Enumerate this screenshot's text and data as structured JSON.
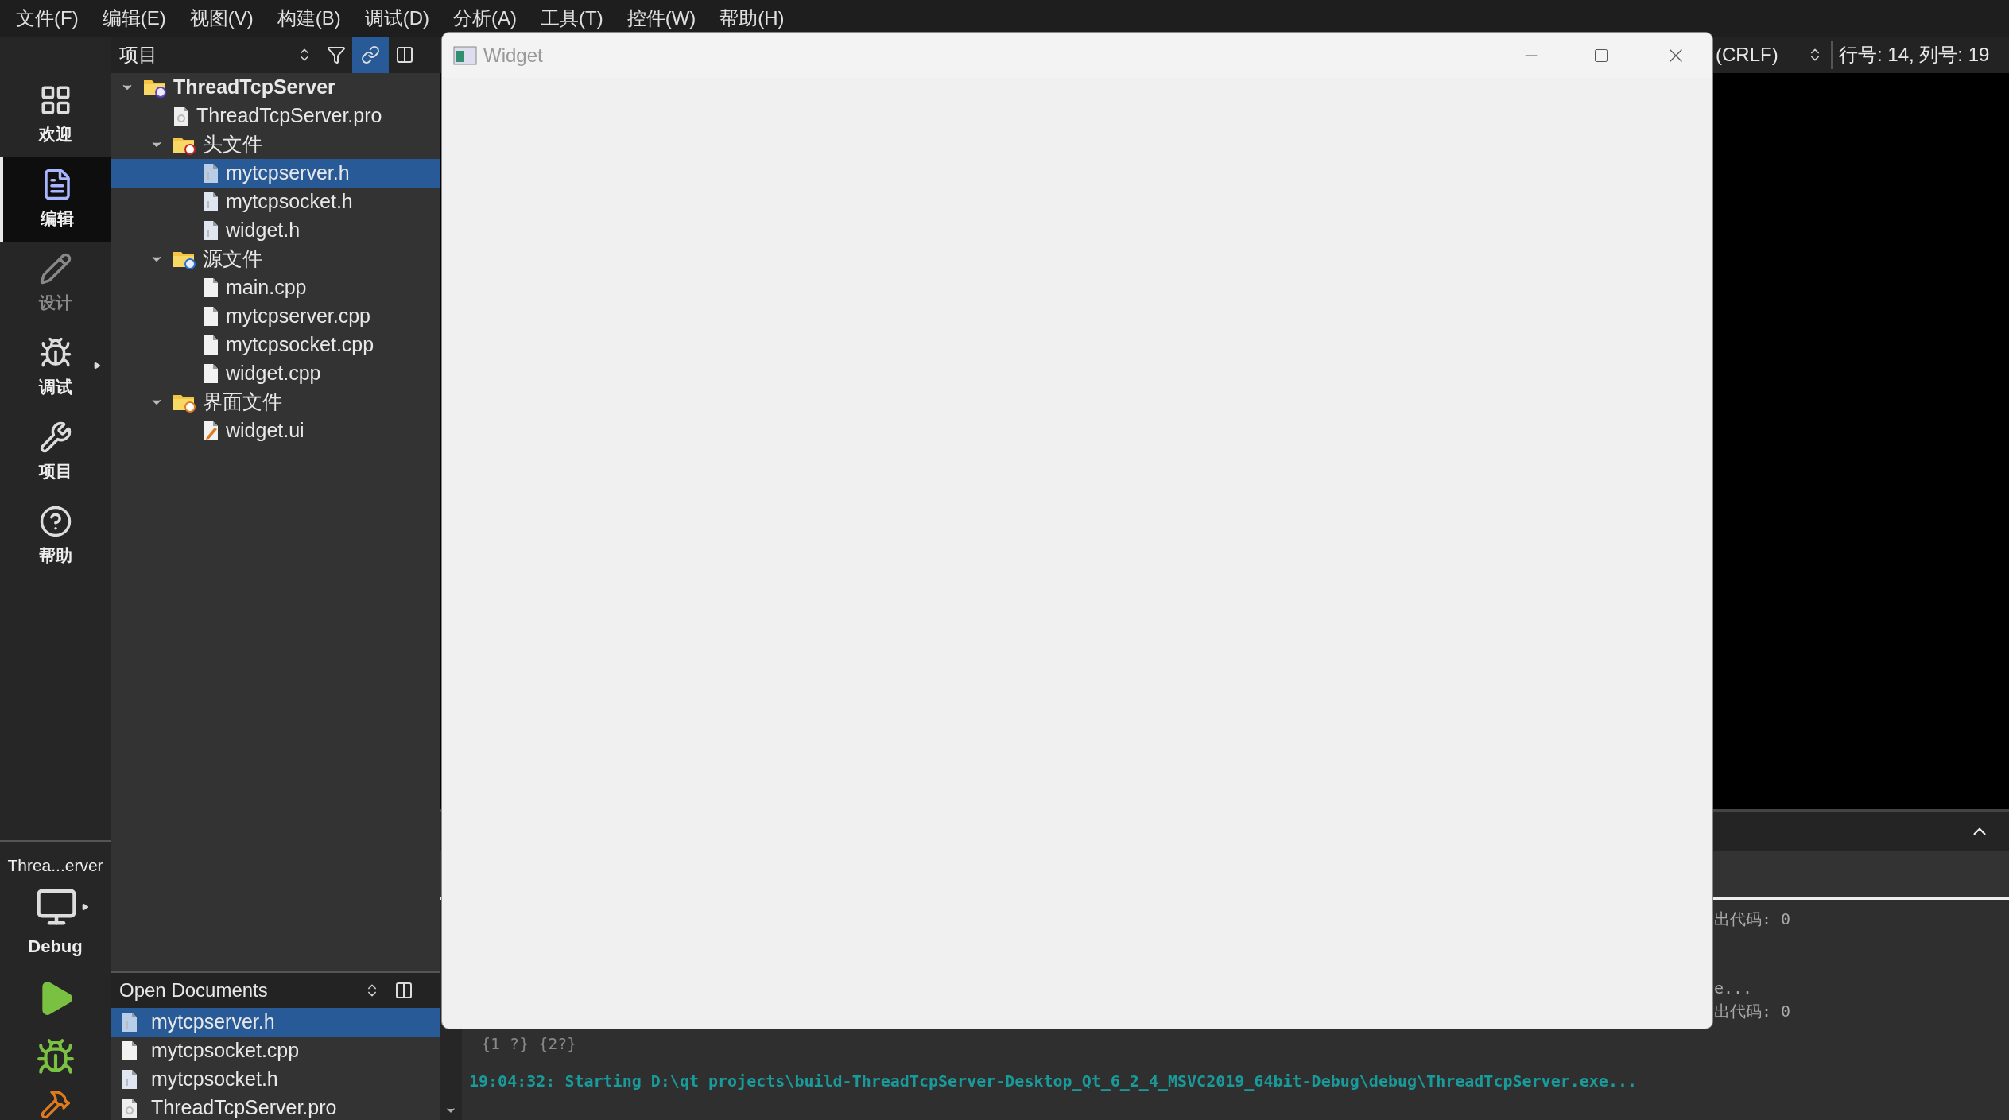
{
  "menu": [
    "文件(F)",
    "编辑(E)",
    "视图(V)",
    "构建(B)",
    "调试(D)",
    "分析(A)",
    "工具(T)",
    "控件(W)",
    "帮助(H)"
  ],
  "modes": [
    {
      "label": "欢迎",
      "kind": "welcome",
      "selected": false,
      "disabled": false
    },
    {
      "label": "编辑",
      "kind": "edit",
      "selected": true,
      "disabled": false
    },
    {
      "label": "设计",
      "kind": "design",
      "selected": false,
      "disabled": true
    },
    {
      "label": "调试",
      "kind": "debug",
      "selected": false,
      "disabled": false
    },
    {
      "label": "项目",
      "kind": "projects",
      "selected": false,
      "disabled": false
    },
    {
      "label": "帮助",
      "kind": "help",
      "selected": false,
      "disabled": false
    }
  ],
  "target": {
    "project": "Threa...erver",
    "config": "Debug"
  },
  "project_panel": {
    "selector": "项目",
    "tree": [
      {
        "label": "ThreadTcpServer",
        "kind": "project",
        "expanded": true,
        "selected": false,
        "children": [
          {
            "label": "ThreadTcpServer.pro",
            "kind": "pro",
            "selected": false
          },
          {
            "label": "头文件",
            "kind": "folder_h",
            "expanded": true,
            "selected": false,
            "children": [
              {
                "label": "mytcpserver.h",
                "kind": "h",
                "selected": true
              },
              {
                "label": "mytcpsocket.h",
                "kind": "h",
                "selected": false
              },
              {
                "label": "widget.h",
                "kind": "h",
                "selected": false
              }
            ]
          },
          {
            "label": "源文件",
            "kind": "folder_cpp",
            "expanded": true,
            "selected": false,
            "children": [
              {
                "label": "main.cpp",
                "kind": "cpp",
                "selected": false
              },
              {
                "label": "mytcpserver.cpp",
                "kind": "cpp",
                "selected": false
              },
              {
                "label": "mytcpsocket.cpp",
                "kind": "cpp",
                "selected": false
              },
              {
                "label": "widget.cpp",
                "kind": "cpp",
                "selected": false
              }
            ]
          },
          {
            "label": "界面文件",
            "kind": "folder_ui",
            "expanded": true,
            "selected": false,
            "children": [
              {
                "label": "widget.ui",
                "kind": "ui",
                "selected": false
              }
            ]
          }
        ]
      }
    ]
  },
  "open_documents": {
    "title": "Open Documents",
    "items": [
      {
        "label": "mytcpserver.h",
        "kind": "h",
        "selected": true
      },
      {
        "label": "mytcpsocket.cpp",
        "kind": "cpp",
        "selected": false
      },
      {
        "label": "mytcpsocket.h",
        "kind": "h",
        "selected": false
      },
      {
        "label": "ThreadTcpServer.pro",
        "kind": "pro",
        "selected": false
      }
    ]
  },
  "editor_toolbar": {
    "line_ending": "(CRLF)",
    "position": "行号: 14, 列号: 19"
  },
  "output": {
    "lines": [
      {
        "text": "出代码: 0",
        "kind": "clipped"
      },
      {
        "text": "e...",
        "kind": "clipped"
      },
      {
        "text": "出代码: 0",
        "kind": "clipped"
      },
      {
        "text": "{1 ?} {2?}",
        "kind": "plain"
      },
      {
        "text": "19:04:32: Starting D:\\qt projects\\build-ThreadTcpServer-Desktop_Qt_6_2_4_MSVC2019_64bit-Debug\\debug\\ThreadTcpServer.exe...",
        "kind": "status"
      }
    ]
  },
  "widget_window": {
    "title": "Widget"
  }
}
